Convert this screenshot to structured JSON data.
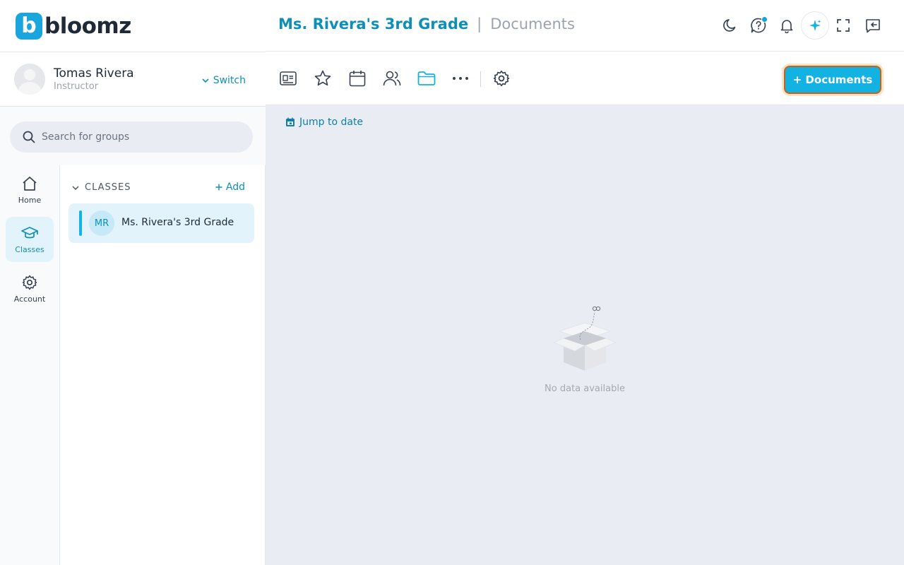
{
  "brand": {
    "badge_letter": "b",
    "name": "bloomz"
  },
  "user": {
    "name": "Tomas Rivera",
    "role": "Instructor",
    "switch_label": "Switch"
  },
  "search": {
    "placeholder": "Search for groups"
  },
  "rail": [
    {
      "label": "Home",
      "icon": "home-icon",
      "active": false
    },
    {
      "label": "Classes",
      "icon": "graduation-cap-icon",
      "active": true
    },
    {
      "label": "Account",
      "icon": "gear-icon",
      "active": false
    }
  ],
  "classes": {
    "heading": "CLASSES",
    "add_label": "Add",
    "items": [
      {
        "initials": "MR",
        "name": "Ms. Rivera's 3rd Grade",
        "selected": true
      }
    ]
  },
  "header": {
    "class_name": "Ms. Rivera's 3rd Grade",
    "separator": "|",
    "page": "Documents"
  },
  "top_icons": [
    "moon-icon",
    "help-chat-icon",
    "bell-icon",
    "ai-sparkle-icon",
    "fullscreen-icon",
    "collapse-panel-icon"
  ],
  "toolbar": {
    "tabs": [
      "newsletter-icon",
      "star-icon",
      "calendar-icon",
      "people-icon",
      "folder-icon",
      "more-icon",
      "settings-icon"
    ],
    "active_tab": "folder-icon",
    "add_button_label": "+ Documents"
  },
  "main": {
    "jump_label": "Jump to date",
    "empty_text": "No data available"
  },
  "colors": {
    "accent": "#12b2e3",
    "accent_dark": "#0e8fb8",
    "active_bg": "#e3f3fb",
    "panel_bg": "#e9edf3"
  }
}
